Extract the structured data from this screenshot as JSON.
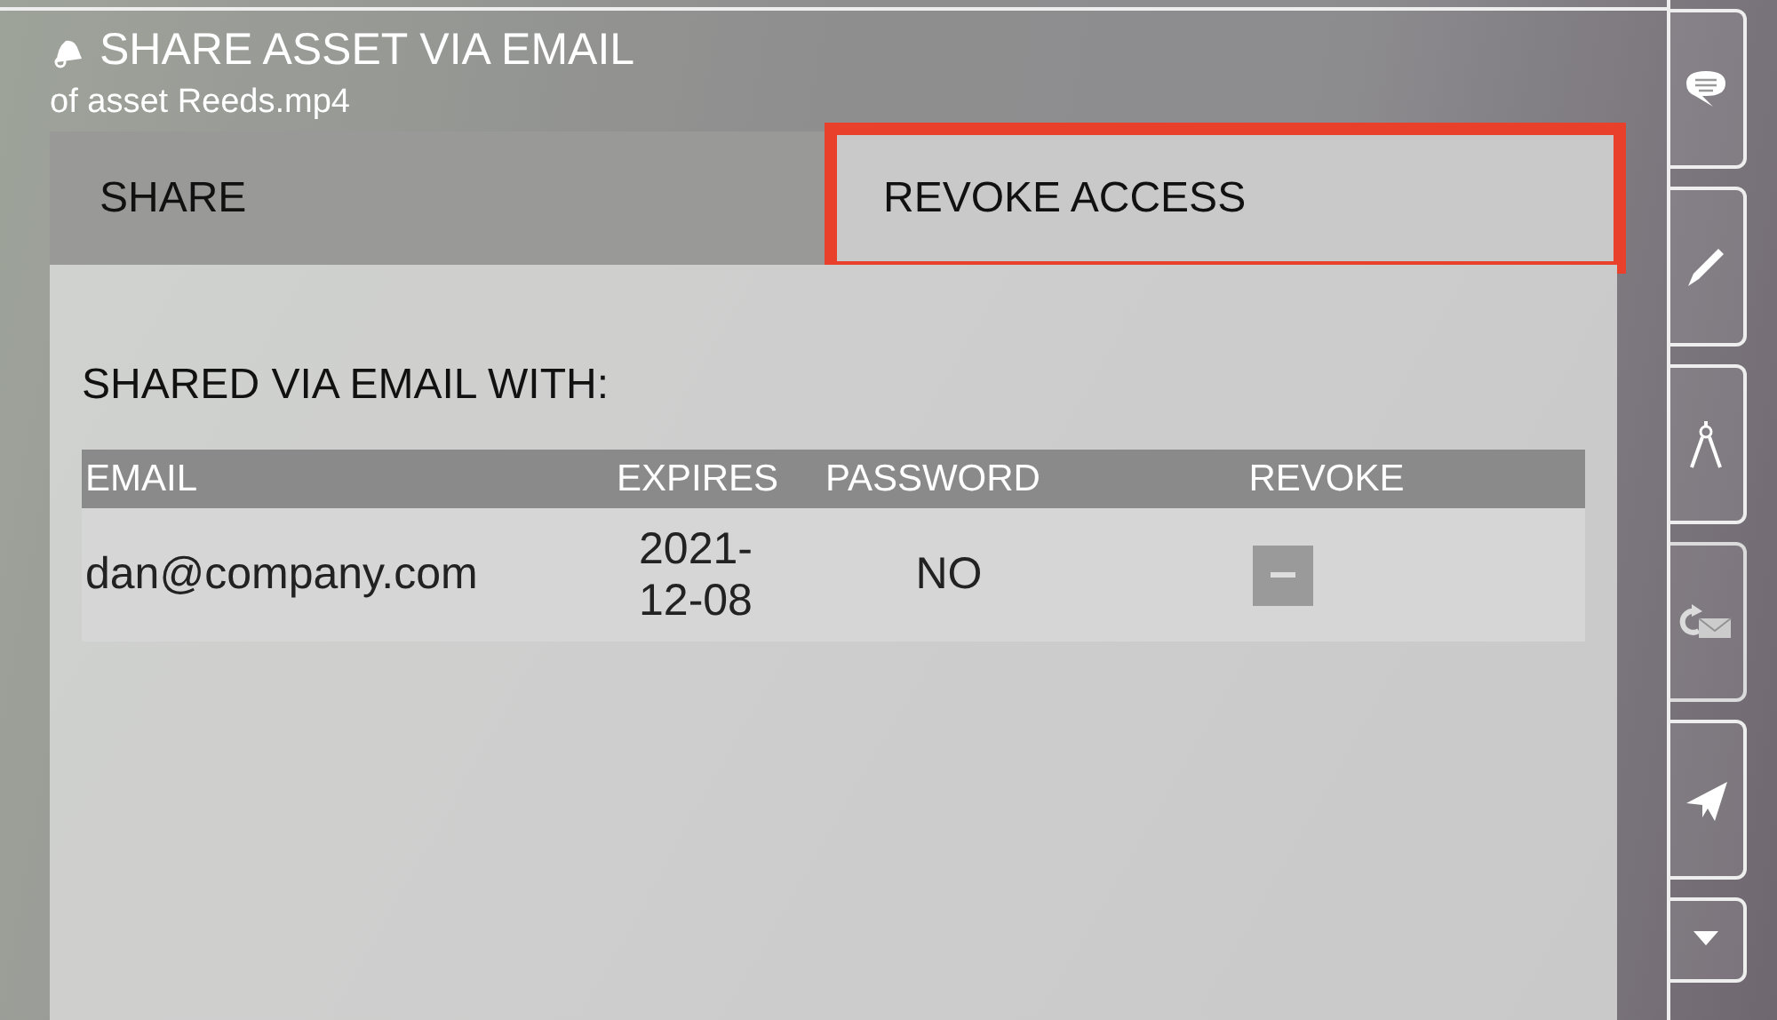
{
  "header": {
    "title": "SHARE ASSET VIA EMAIL",
    "subtitle": "of asset Reeds.mp4"
  },
  "tabs": [
    {
      "label": "SHARE",
      "selected": false,
      "highlighted": false
    },
    {
      "label": "REVOKE ACCESS",
      "selected": true,
      "highlighted": true
    }
  ],
  "section_title": "SHARED VIA EMAIL WITH:",
  "table": {
    "columns": [
      "EMAIL",
      "EXPIRES",
      "PASSWORD",
      "REVOKE"
    ],
    "rows": [
      {
        "email": "dan@company.com",
        "expires": "2021-12-08",
        "password": "NO"
      }
    ]
  }
}
